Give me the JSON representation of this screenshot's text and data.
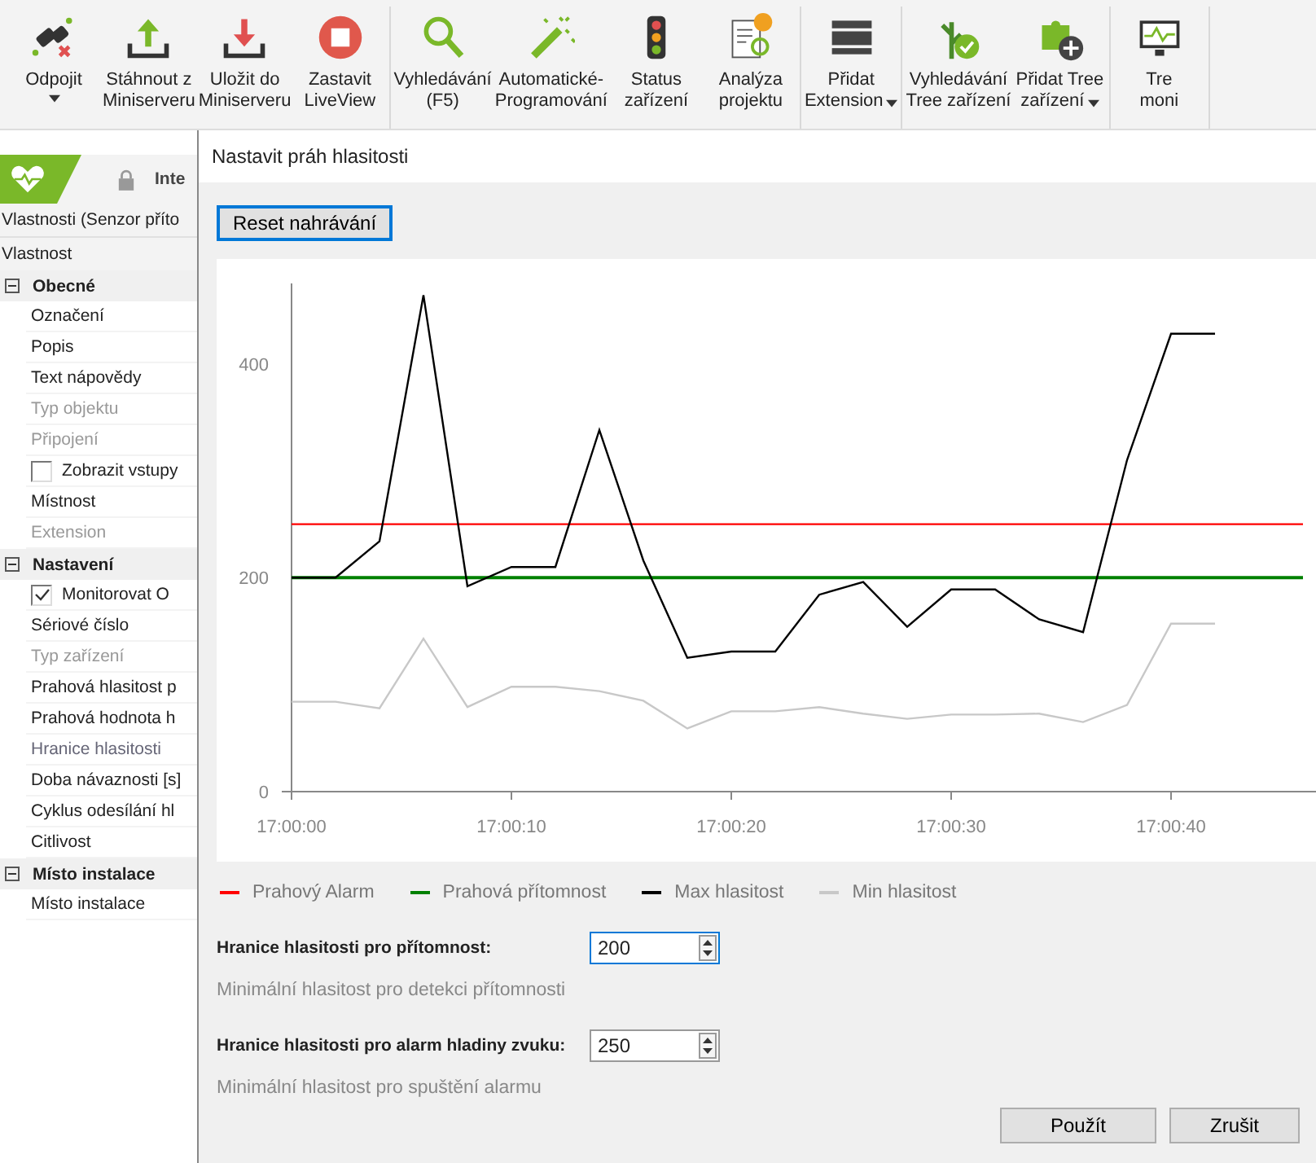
{
  "toolbar": {
    "groups": [
      {
        "items": [
          {
            "label": [
              "Odpojit"
            ],
            "dropdown": true
          },
          {
            "label": [
              "Stáhnout z",
              "Miniserveru"
            ],
            "dropdown": false
          },
          {
            "label": [
              "Uložit do",
              "Miniserveru"
            ],
            "dropdown": false
          },
          {
            "label": [
              "Zastavit",
              "LiveView"
            ],
            "dropdown": false
          }
        ]
      },
      {
        "items": [
          {
            "label": [
              "Vyhledávání",
              "(F5)"
            ],
            "dropdown": false
          },
          {
            "label": [
              "Automatické-",
              "Programování"
            ],
            "dropdown": false
          },
          {
            "label": [
              "Status",
              "zařízení"
            ],
            "dropdown": false
          },
          {
            "label": [
              "Analýza",
              "projektu"
            ],
            "dropdown": false
          }
        ]
      },
      {
        "items": [
          {
            "label": [
              "Přidat",
              "Extension"
            ],
            "dropdown": true
          }
        ]
      },
      {
        "items": [
          {
            "label": [
              "Vyhledávání",
              "Tree zařízení"
            ],
            "dropdown": false
          },
          {
            "label": [
              "Přidat Tree",
              "zařízení"
            ],
            "dropdown": true
          }
        ]
      },
      {
        "items": [
          {
            "label": [
              "Tre",
              "moni"
            ],
            "dropdown": false
          }
        ]
      }
    ]
  },
  "left_panel": {
    "tab": {
      "label": "Inte",
      "locked": true
    },
    "title": "Vlastnosti (Senzor příto",
    "column": "Vlastnost",
    "groups": [
      {
        "label": "Obecné",
        "expanded": true,
        "children": [
          {
            "label": "Označení",
            "kind": "text"
          },
          {
            "label": "Popis",
            "kind": "text"
          },
          {
            "label": "Text nápovědy",
            "kind": "text"
          },
          {
            "label": "Typ objektu",
            "kind": "readonly"
          },
          {
            "label": "Připojení",
            "kind": "readonly"
          },
          {
            "label": "Zobrazit vstupy",
            "kind": "checkbox",
            "checked": false
          },
          {
            "label": "Místnost",
            "kind": "text"
          },
          {
            "label": "Extension",
            "kind": "readonly"
          }
        ]
      },
      {
        "label": "Nastavení",
        "expanded": true,
        "children": [
          {
            "label": "Monitorovat O",
            "kind": "checkbox",
            "checked": true
          },
          {
            "label": "Sériové číslo",
            "kind": "text"
          },
          {
            "label": "Typ zařízení",
            "kind": "readonly"
          },
          {
            "label": "Prahová hlasitost p",
            "kind": "text"
          },
          {
            "label": "Prahová hodnota h",
            "kind": "text"
          },
          {
            "label": "Hranice hlasitosti",
            "kind": "dim"
          },
          {
            "label": "Doba návaznosti [s]",
            "kind": "text"
          },
          {
            "label": "Cyklus odesílání hl",
            "kind": "text"
          },
          {
            "label": "Citlivost",
            "kind": "text"
          }
        ]
      },
      {
        "label": "Místo instalace",
        "expanded": true,
        "children": [
          {
            "label": "Místo instalace",
            "kind": "text"
          }
        ]
      }
    ]
  },
  "dialog": {
    "title": "Nastavit práh hlasitosti",
    "reset_button": "Reset nahrávání",
    "chart_data": {
      "type": "line",
      "categories": [
        "17:00:00",
        null,
        null,
        null,
        null,
        "17:00:10",
        null,
        null,
        null,
        null,
        "17:00:20",
        null,
        null,
        null,
        null,
        "17:00:30",
        null,
        null,
        null,
        null,
        "17:00:40",
        null,
        null,
        null
      ],
      "ylim": [
        0,
        475
      ],
      "yticks": [
        0,
        200,
        400
      ],
      "series": [
        {
          "name": "Prahový Alarm",
          "color": "#ff0000",
          "values": [
            250,
            250,
            250,
            250,
            250,
            250,
            250,
            250,
            250,
            250,
            250,
            250,
            250,
            250,
            250,
            250,
            250,
            250,
            250,
            250,
            250,
            250,
            250,
            250
          ]
        },
        {
          "name": "Prahová přítomnost",
          "color": "#008000",
          "values": [
            200,
            200,
            200,
            200,
            200,
            200,
            200,
            200,
            200,
            200,
            200,
            200,
            200,
            200,
            200,
            200,
            200,
            200,
            200,
            200,
            200,
            200,
            200,
            200
          ]
        },
        {
          "name": "Max hlasitost",
          "color": "#000000",
          "values": [
            200,
            200,
            234,
            464,
            192,
            210,
            210,
            338,
            216,
            125,
            131,
            131,
            184,
            196,
            154,
            189,
            189,
            161,
            149,
            310,
            428,
            428,
            null,
            null
          ]
        },
        {
          "name": "Min hlasitost",
          "color": "#c8c8c8",
          "values": [
            84,
            84,
            78,
            143,
            79,
            98,
            98,
            94,
            85,
            59,
            75,
            75,
            79,
            73,
            68,
            72,
            72,
            73,
            65,
            81,
            157,
            157,
            null,
            null
          ]
        }
      ]
    },
    "fields": [
      {
        "label": "Hranice hlasitosti pro přítomnost:",
        "value": "200",
        "hint": "Minimální hlasitost pro detekci přítomnosti",
        "focused": true
      },
      {
        "label": "Hranice hlasitosti pro alarm hladiny zvuku:",
        "value": "250",
        "hint": "Minimální hlasitost pro spuštění alarmu",
        "focused": false
      }
    ],
    "buttons": [
      "Použít",
      "Zrušit"
    ]
  }
}
